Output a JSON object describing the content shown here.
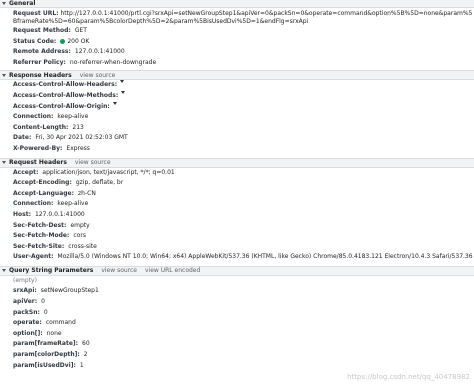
{
  "general": {
    "title": "General",
    "request_url_label": "Request URL:",
    "request_url_value": "http://127.0.0.1:41000/prtl.cgi?srxApi=setNewGroupStep1&apiVer=0&packSn=0&operate=command&option%5B%5D=none&param%5BframeRate%5D=60&param%5BcolorDepth%5D=2&param%5BisUsedDvi%5D=1&endFlg=srxApi",
    "request_method_label": "Request Method:",
    "request_method_value": "GET",
    "status_code_label": "Status Code:",
    "status_code_value": "200 OK",
    "remote_address_label": "Remote Address:",
    "remote_address_value": "127.0.0.1:41000",
    "referrer_policy_label": "Referrer Policy:",
    "referrer_policy_value": "no-referrer-when-downgrade"
  },
  "response_headers": {
    "title": "Response Headers",
    "view_source": "view source",
    "items": [
      {
        "key": "Access-Control-Allow-Headers:",
        "value": "",
        "menu": true
      },
      {
        "key": "Access-Control-Allow-Methods:",
        "value": "",
        "menu": true
      },
      {
        "key": "Access-Control-Allow-Origin:",
        "value": "",
        "menu": true
      },
      {
        "key": "Connection:",
        "value": "keep-alive",
        "menu": false
      },
      {
        "key": "Content-Length:",
        "value": "213",
        "menu": false
      },
      {
        "key": "Date:",
        "value": "Fri, 30 Apr 2021 02:52:03 GMT",
        "menu": false
      },
      {
        "key": "X-Powered-By:",
        "value": "Express",
        "menu": false
      }
    ]
  },
  "request_headers": {
    "title": "Request Headers",
    "view_source": "view source",
    "items": [
      {
        "key": "Accept:",
        "value": "application/json, text/javascript, */*; q=0.01"
      },
      {
        "key": "Accept-Encoding:",
        "value": "gzip, deflate, br"
      },
      {
        "key": "Accept-Language:",
        "value": "zh-CN"
      },
      {
        "key": "Connection:",
        "value": "keep-alive"
      },
      {
        "key": "Host:",
        "value": "127.0.0.1:41000"
      },
      {
        "key": "Sec-Fetch-Dest:",
        "value": "empty"
      },
      {
        "key": "Sec-Fetch-Mode:",
        "value": "cors"
      },
      {
        "key": "Sec-Fetch-Site:",
        "value": "cross-site"
      },
      {
        "key": "User-Agent:",
        "value": "Mozilla/5.0 (Windows NT 10.0; Win64; x64) AppleWebKit/537.36 (KHTML, like Gecko) Chrome/85.0.4183.121 Electron/10.4.3 Safari/537.36"
      }
    ]
  },
  "query_params": {
    "title": "Query String Parameters",
    "view_source": "view source",
    "view_url_encoded": "view URL encoded",
    "empty_label": "(empty)",
    "items": [
      {
        "key": "srxApi:",
        "value": "setNewGroupStep1"
      },
      {
        "key": "apiVer:",
        "value": "0"
      },
      {
        "key": "packSn:",
        "value": "0"
      },
      {
        "key": "operate:",
        "value": "command"
      },
      {
        "key": "option[]:",
        "value": "none"
      },
      {
        "key": "param[frameRate]:",
        "value": "60"
      },
      {
        "key": "param[colorDepth]:",
        "value": "2"
      },
      {
        "key": "param[isUsedDvi]:",
        "value": "1"
      }
    ]
  },
  "watermark": "https://blog.csdn.net/qq_40478982"
}
